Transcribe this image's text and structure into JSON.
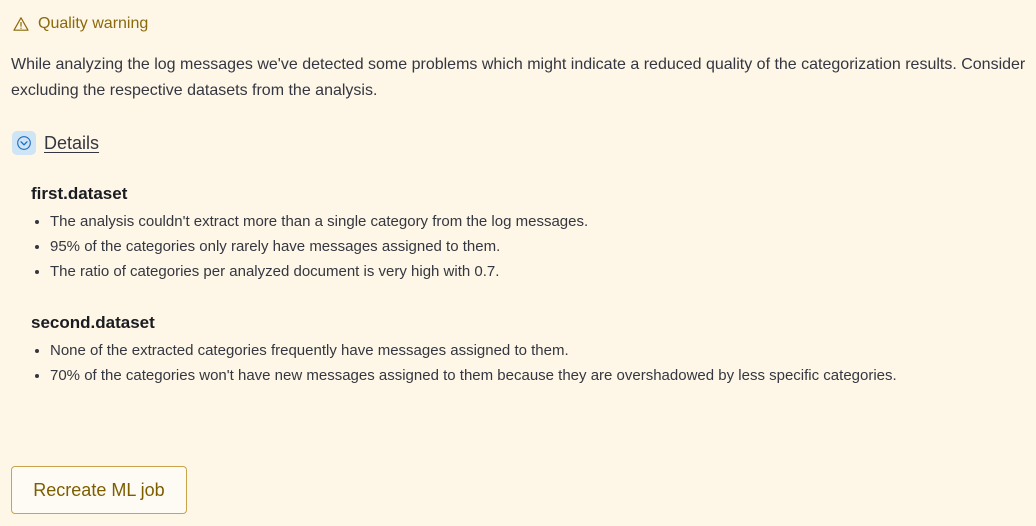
{
  "callout": {
    "icon": "warning-icon",
    "title": "Quality warning",
    "description": "While analyzing the log messages we've detected some problems which might indicate a reduced quality of the categorization results. Consider excluding the respective datasets from the analysis."
  },
  "details": {
    "icon": "chevron-down-icon",
    "label": "Details",
    "expanded": true,
    "datasets": [
      {
        "name": "first.dataset",
        "issues": [
          "The analysis couldn't extract more than a single category from the log messages.",
          "95% of the categories only rarely have messages assigned to them.",
          "The ratio of categories per analyzed document is very high with 0.7."
        ]
      },
      {
        "name": "second.dataset",
        "issues": [
          "None of the extracted categories frequently have messages assigned to them.",
          "70% of the categories won't have new messages assigned to them because they are overshadowed by less specific categories."
        ]
      }
    ]
  },
  "actions": {
    "recreate_label": "Recreate ML job"
  },
  "colors": {
    "background": "#fef6e6",
    "warning_text": "#8a6a0a",
    "button_border": "#c9a44a",
    "chevron_bg": "#cfe4f5"
  }
}
